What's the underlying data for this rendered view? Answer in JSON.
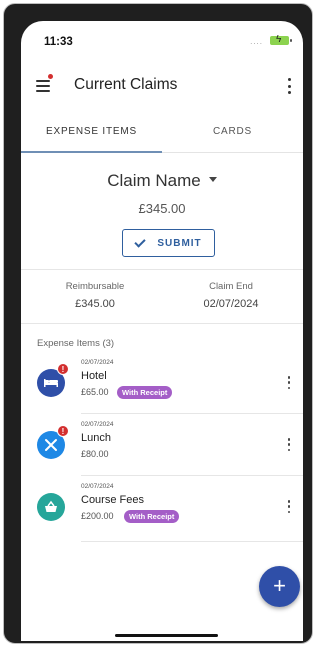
{
  "status_bar": {
    "time": "11:33",
    "signal": "....",
    "battery_color": "#8cd34f"
  },
  "app_bar": {
    "title": "Current Claims",
    "menu_icon": "hamburger-icon",
    "notification_dot_color": "#d32f2f"
  },
  "tabs": [
    {
      "label": "EXPENSE ITEMS",
      "active": true
    },
    {
      "label": "CARDS",
      "active": false
    }
  ],
  "claim": {
    "name": "Claim Name",
    "total": "£345.00",
    "submit_label": "SUBMIT"
  },
  "summary": {
    "reimbursable_label": "Reimbursable",
    "reimbursable_value": "£345.00",
    "claim_end_label": "Claim End",
    "claim_end_value": "02/07/2024"
  },
  "expenses": {
    "section_title": "Expense Items (3)",
    "items": [
      {
        "date": "02/07/2024",
        "name": "Hotel",
        "amount": "£65.00",
        "receipt": "With Receipt",
        "icon": "bed-icon",
        "color": "#2f4fa8",
        "alert": "!"
      },
      {
        "date": "02/07/2024",
        "name": "Lunch",
        "amount": "£80.00",
        "receipt": "",
        "icon": "cutlery-icon",
        "color": "#1e88e5",
        "alert": "!"
      },
      {
        "date": "02/07/2024",
        "name": "Course Fees",
        "amount": "£200.00",
        "receipt": "With Receipt",
        "icon": "basket-icon",
        "color": "#26a69a",
        "alert": ""
      }
    ]
  },
  "fab": {
    "label": "+",
    "color": "#2f4fa8"
  },
  "colors": {
    "accent": "#2f5f9e",
    "receipt_pill": "#a45ec7",
    "badge": "#d32f2f"
  }
}
